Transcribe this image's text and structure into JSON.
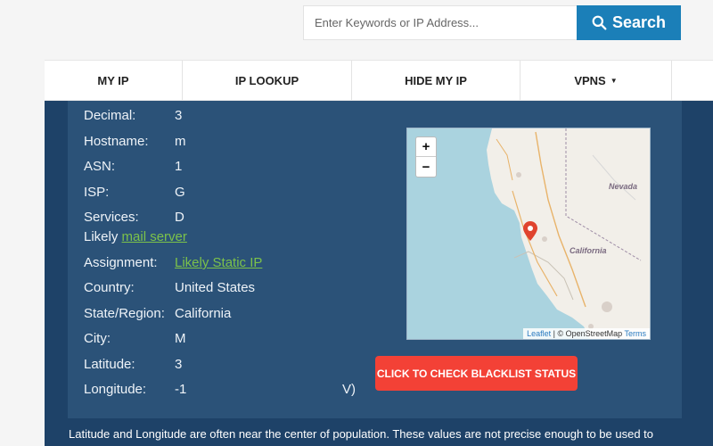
{
  "search": {
    "placeholder": "Enter Keywords or IP Address...",
    "button_label": "Search"
  },
  "nav": {
    "items": [
      {
        "label": "MY IP"
      },
      {
        "label": "IP LOOKUP"
      },
      {
        "label": "HIDE MY IP"
      },
      {
        "label": "VPNS"
      }
    ],
    "vpns_caret": "▼"
  },
  "details": {
    "decimal": {
      "label": "Decimal:",
      "value": "3"
    },
    "hostname": {
      "label": "Hostname:",
      "value": "m"
    },
    "asn": {
      "label": "ASN:",
      "value": "1"
    },
    "isp": {
      "label": "ISP:",
      "value": "G"
    },
    "services": {
      "label": "Services:",
      "value": "D"
    },
    "likely_prefix": "Likely",
    "likely_link": "mail server",
    "assignment": {
      "label": "Assignment:",
      "value": "Likely Static IP"
    },
    "country": {
      "label": "Country:",
      "value": "United States"
    },
    "state": {
      "label": "State/Region:",
      "value": "California"
    },
    "city": {
      "label": "City:",
      "value": "M"
    },
    "latitude": {
      "label": "Latitude:",
      "value": "3"
    },
    "longitude": {
      "label": "Longitude:",
      "value": "-1",
      "trailing": "V)"
    }
  },
  "map": {
    "zoom_in": "+",
    "zoom_out": "−",
    "label_nevada": "Nevada",
    "label_california": "California",
    "attribution_leaflet": "Leaflet",
    "attribution_sep": " | © OpenStreetMap ",
    "attribution_terms": "Terms",
    "marker_color": "#e0442f"
  },
  "blacklist_button": "CLICK TO CHECK BLACKLIST STATUS",
  "note": "Latitude and Longitude are often near the center of population. These values are not precise enough to be used to",
  "colors": {
    "search_button": "#1b7fb8",
    "panel": "#2b5278",
    "outer": "#1e4268",
    "link": "#7cc24a",
    "blacklist": "#f34136"
  }
}
